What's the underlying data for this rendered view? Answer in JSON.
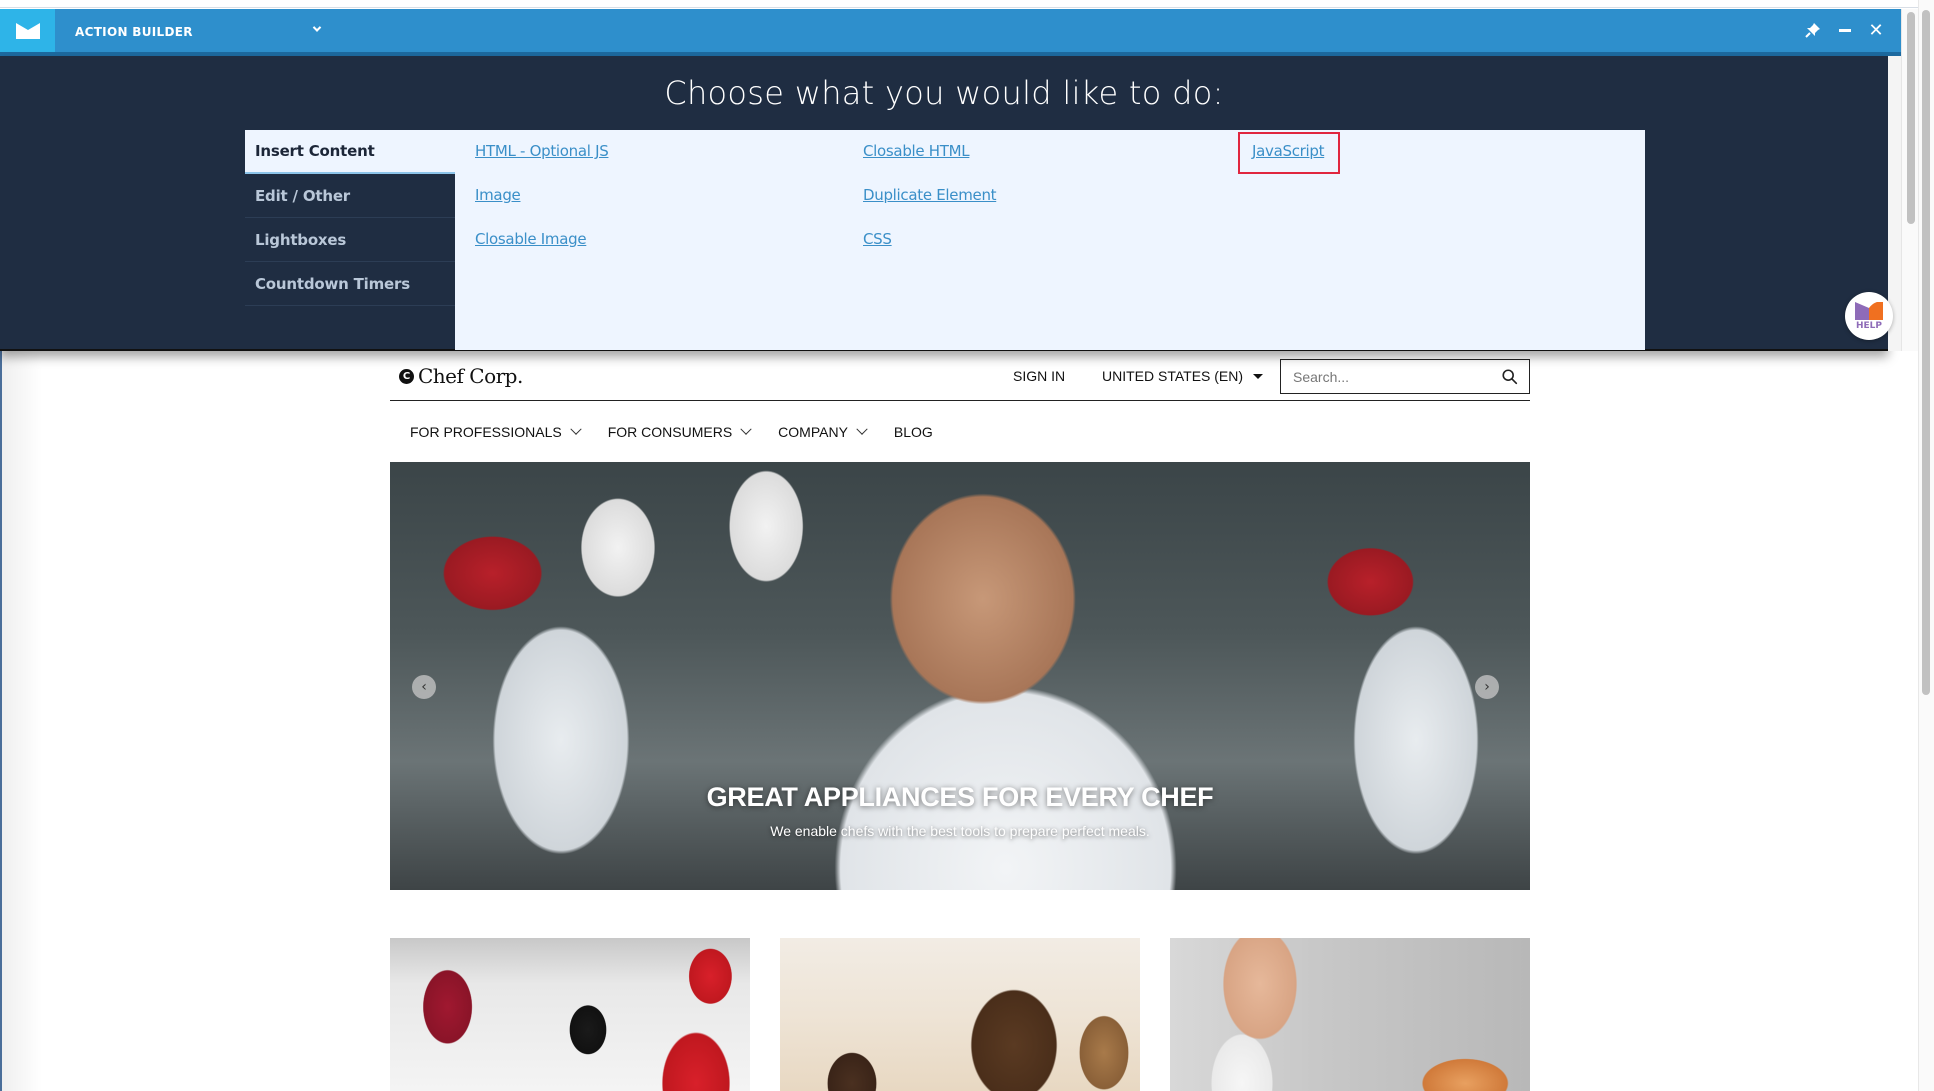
{
  "action_builder": {
    "title": "ACTION BUILDER",
    "heading": "Choose what you would like to do:",
    "controls": {
      "pin_icon": "pin-icon",
      "minimize_icon": "minimize-icon",
      "close_icon": "close-icon",
      "close_glyph": "✕"
    },
    "tabs": [
      {
        "label": "Insert Content",
        "active": true
      },
      {
        "label": "Edit / Other",
        "active": false
      },
      {
        "label": "Lightboxes",
        "active": false
      },
      {
        "label": "Countdown Timers",
        "active": false
      }
    ],
    "actions": [
      {
        "label": "HTML - Optional JS",
        "column": 1,
        "row": 1
      },
      {
        "label": "Image",
        "column": 1,
        "row": 2
      },
      {
        "label": "Closable Image",
        "column": 1,
        "row": 3
      },
      {
        "label": "Closable HTML",
        "column": 2,
        "row": 1
      },
      {
        "label": "Duplicate Element",
        "column": 2,
        "row": 2
      },
      {
        "label": "CSS",
        "column": 2,
        "row": 3
      },
      {
        "label": "JavaScript",
        "column": 3,
        "row": 1,
        "highlighted": true
      }
    ],
    "help_label": "HELP",
    "colors": {
      "bar": "#2e8fcc",
      "logo_block": "#2eb4e8",
      "panel": "#1f2d42",
      "content_bg": "#eef5ff",
      "link": "#3a8fc8",
      "highlight": "#e0263f"
    }
  },
  "site": {
    "brand": "Chef Corp.",
    "brand_mark": "C",
    "sign_in": "SIGN IN",
    "region": "UNITED STATES (EN)",
    "search": {
      "placeholder": "Search...",
      "value": ""
    },
    "nav": [
      {
        "label": "FOR PROFESSIONALS",
        "has_dropdown": true
      },
      {
        "label": "FOR CONSUMERS",
        "has_dropdown": true
      },
      {
        "label": "COMPANY",
        "has_dropdown": true
      },
      {
        "label": "BLOG",
        "has_dropdown": false
      }
    ],
    "hero": {
      "title": "GREAT APPLIANCES FOR EVERY CHEF",
      "subtitle": "We enable chefs with the best tools to prepare perfect meals.",
      "prev_glyph": "‹",
      "next_glyph": "›"
    },
    "cards": [
      {
        "image": "chefs-in-kitchen-photo"
      },
      {
        "image": "friends-cooking-photo"
      },
      {
        "image": "waitress-serving-photo"
      }
    ]
  }
}
